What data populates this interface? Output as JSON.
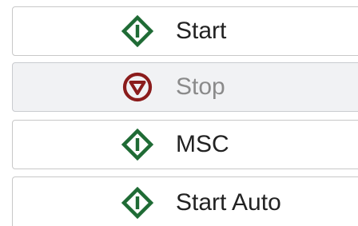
{
  "buttons": {
    "start": {
      "label": "Start",
      "icon": "start-diamond-icon",
      "enabled": true
    },
    "stop": {
      "label": "Stop",
      "icon": "stop-circle-icon",
      "enabled": false
    },
    "msc": {
      "label": "MSC",
      "icon": "start-diamond-icon",
      "enabled": true
    },
    "start_auto": {
      "label": "Start Auto",
      "icon": "start-diamond-icon",
      "enabled": true
    }
  },
  "colors": {
    "start_icon": "#1f6b35",
    "stop_icon": "#8b1c1c",
    "disabled_bg": "#f1f2f4",
    "border": "#c8c8c8"
  }
}
